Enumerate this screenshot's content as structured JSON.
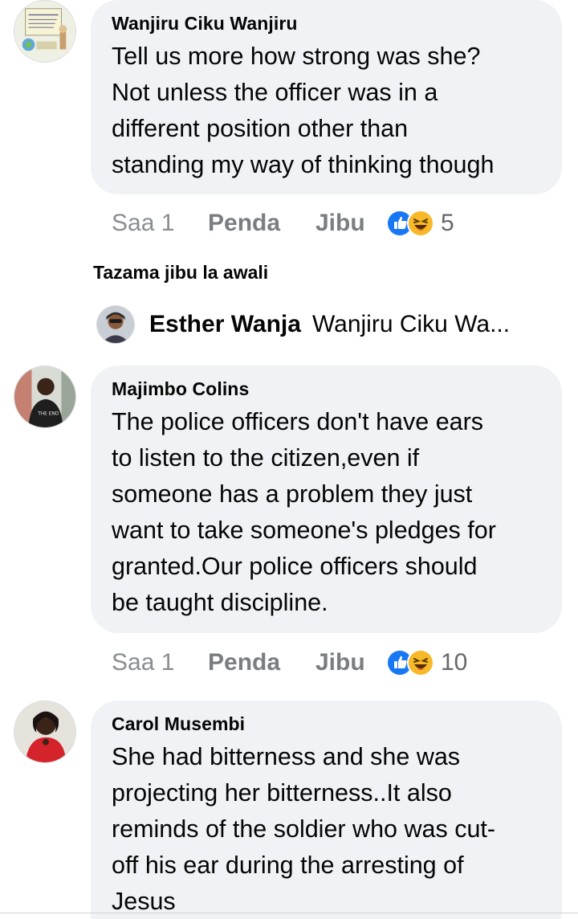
{
  "comments": [
    {
      "author": "Wanjiru Ciku Wanjiru",
      "avatar_icon": "cartoon-sign-avatar-icon",
      "lines": [
        "Tell us more how strong was she?",
        "Not unless the officer was in a",
        "different position other than",
        "standing my way of thinking though"
      ],
      "time": "Saa 1",
      "like_label": "Penda",
      "reply_label": "Jibu",
      "reaction_icons": [
        "like-reaction-icon",
        "haha-reaction-icon"
      ],
      "reaction_count": "5"
    },
    {
      "author": "Majimbo Colins",
      "avatar_icon": "profile-photo-icon",
      "avatar_text": "THE END",
      "lines": [
        "The police officers don't have ears",
        "to listen to the citizen,even if",
        "someone has a problem they just",
        "want to take someone's pledges for",
        "granted.Our police officers should",
        "be taught discipline."
      ],
      "time": "Saa 1",
      "like_label": "Penda",
      "reply_label": "Jibu",
      "reaction_icons": [
        "like-reaction-icon",
        "haha-reaction-icon"
      ],
      "reaction_count": "10"
    },
    {
      "author": "Carol Musembi",
      "avatar_icon": "profile-photo-icon",
      "lines": [
        "She had bitterness and she was",
        "projecting her bitterness..It also",
        "reminds of the soldier who was cut-",
        "off his ear during the arresting of",
        "Jesus"
      ]
    }
  ],
  "view_first_reply": "Tazama jibu la awali",
  "reply_preview": {
    "author": "Esther Wanja",
    "text": "Wanjiru Ciku Wa..."
  },
  "colors": {
    "bubble": "#f0f2f5",
    "like_blue": "#1877f2",
    "haha_yellow": "#f7b928",
    "secondary_text": "#65676b"
  }
}
